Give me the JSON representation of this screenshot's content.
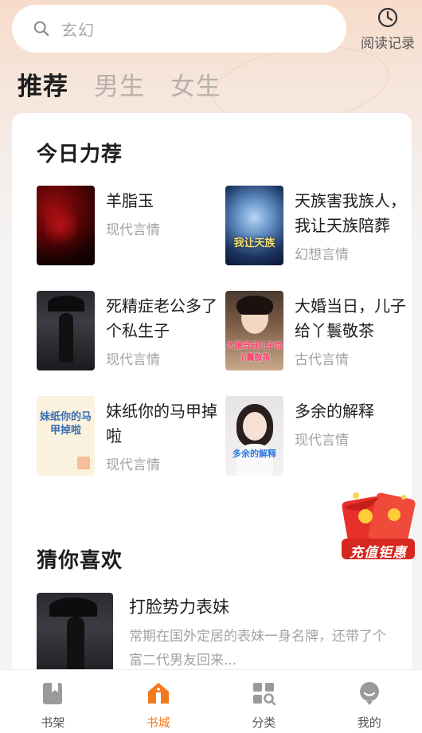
{
  "search": {
    "placeholder": "玄幻"
  },
  "history": {
    "label": "阅读记录"
  },
  "tabs": [
    {
      "label": "推荐",
      "active": true
    },
    {
      "label": "男生",
      "active": false
    },
    {
      "label": "女生",
      "active": false
    }
  ],
  "recommend": {
    "title": "今日力荐",
    "books": [
      {
        "title": "羊脂玉",
        "genre": "现代言情"
      },
      {
        "title": "天族害我族人，我让天族陪葬",
        "genre": "幻想言情",
        "cover_text": "我让天族"
      },
      {
        "title": "死精症老公多了个私生子",
        "genre": "现代言情"
      },
      {
        "title": "大婚当日，儿子给丫鬟敬茶",
        "genre": "古代言情",
        "cover_text": "大婚当日儿子给丫鬟敬茶"
      },
      {
        "title": "妹纸你的马甲掉啦",
        "genre": "现代言情",
        "cover_text": "妹纸你的马甲掉啦"
      },
      {
        "title": "多余的解释",
        "genre": "现代言情",
        "cover_text": "多余的解释"
      }
    ]
  },
  "guess": {
    "title": "猜你喜欢",
    "book": {
      "title": "打脸势力表妹",
      "desc": "常期在国外定居的表妹一身名牌，还带了个富二代男友回来..."
    }
  },
  "promo": {
    "label": "充值钜惠"
  },
  "nav": [
    {
      "label": "书架",
      "icon": "bookshelf-icon",
      "active": false
    },
    {
      "label": "书城",
      "icon": "bookstore-icon",
      "active": true
    },
    {
      "label": "分类",
      "icon": "category-icon",
      "active": false
    },
    {
      "label": "我的",
      "icon": "profile-icon",
      "active": false
    }
  ],
  "colors": {
    "accent": "#f37920",
    "background": "#f4f4f5",
    "promo_red": "#e8302a"
  }
}
